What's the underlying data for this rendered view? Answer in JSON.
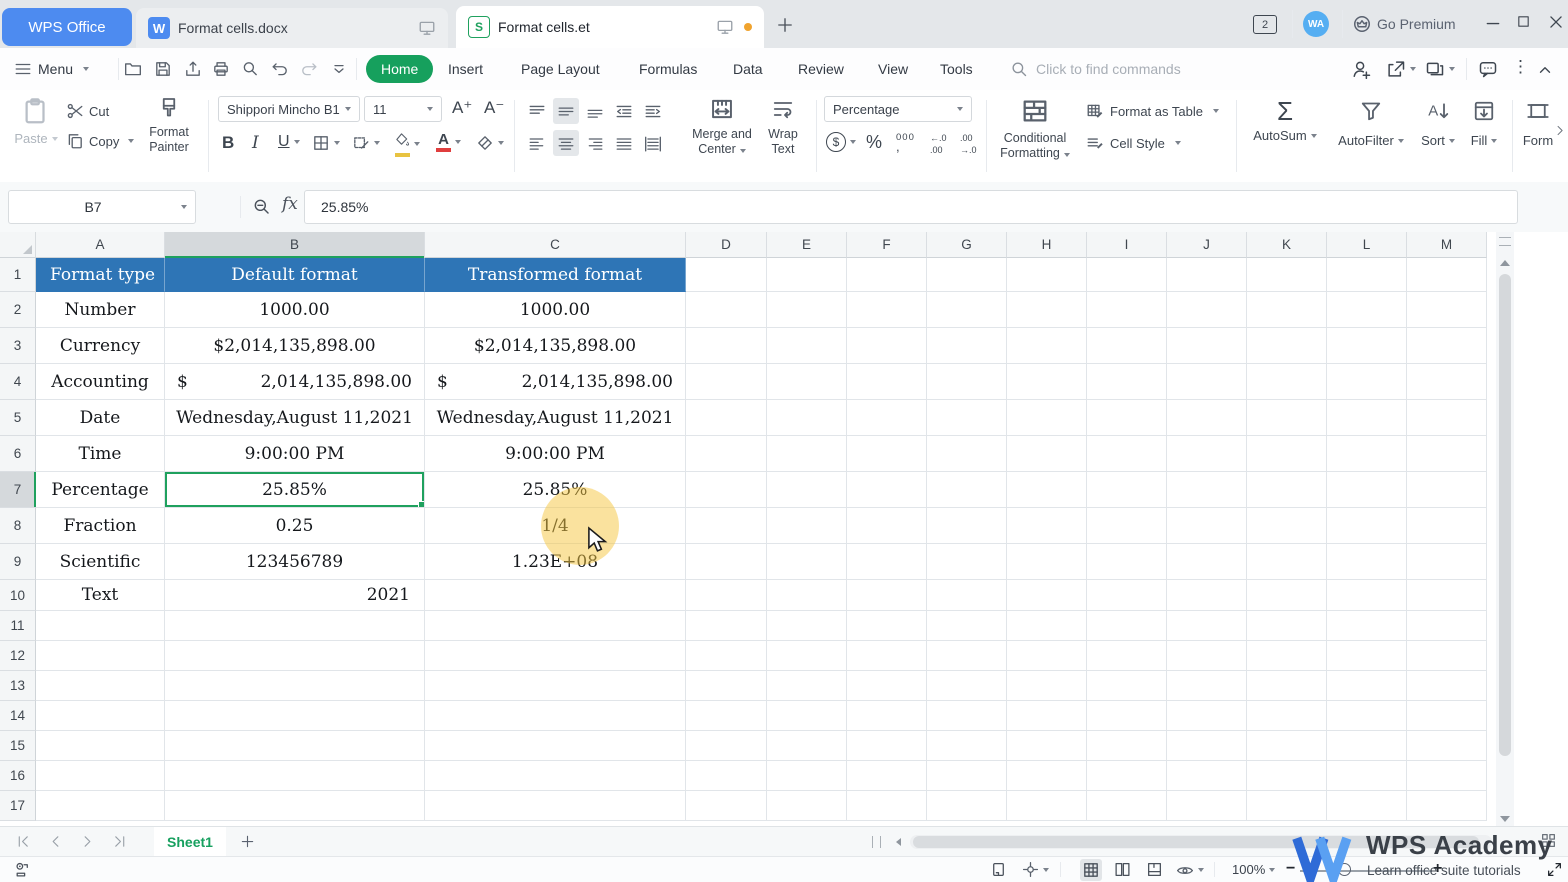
{
  "titlebar": {
    "app_button": "WPS Office",
    "doc_tab": "Format cells.docx",
    "sheet_tab": "Format cells.et",
    "window_count": "2",
    "avatar_initials": "WA",
    "premium_label": "Go Premium"
  },
  "menubar": {
    "menu_label": "Menu",
    "tabs": [
      "Home",
      "Insert",
      "Page Layout",
      "Formulas",
      "Data",
      "Review",
      "View",
      "Tools"
    ],
    "active_tab": "Home",
    "search_placeholder": "Click to find commands"
  },
  "ribbon": {
    "paste": "Paste",
    "cut": "Cut",
    "copy": "Copy",
    "format_painter_line1": "Format",
    "format_painter_line2": "Painter",
    "font_name": "Shippori Mincho B1",
    "font_size": "11",
    "merge_line1": "Merge and",
    "merge_line2": "Center",
    "wrap_line1": "Wrap",
    "wrap_line2": "Text",
    "number_format": "Percentage",
    "cond_line1": "Conditional",
    "cond_line2": "Formatting",
    "format_as_table": "Format as Table",
    "cell_style": "Cell Style",
    "autosum": "AutoSum",
    "autofilter": "AutoFilter",
    "sort": "Sort",
    "fill": "Fill",
    "form": "Form"
  },
  "glyphs": {
    "writer_icon": "W",
    "sheet_icon": "S",
    "bold": "B",
    "italic": "I",
    "underline": "U",
    "grow_font": "A⁺",
    "shrink_font": "A⁻",
    "currency": "$",
    "percent": "%",
    "thousands": "000",
    "thousands_comma": ",",
    "inc_dec_top": "←.0",
    "inc_dec_bottom": ".00",
    "dec_dec_top": ".00",
    "dec_dec_bottom": "→.0",
    "sigma": "Σ",
    "fx": "fx",
    "dots": "⋮",
    "minus": "−",
    "plus": "+"
  },
  "formula_bar": {
    "name_box": "B7",
    "value": "25.85%"
  },
  "sheet": {
    "columns": [
      "A",
      "B",
      "C",
      "D",
      "E",
      "F",
      "G",
      "H",
      "I",
      "J",
      "K",
      "L",
      "M"
    ],
    "row_count": 17,
    "selected_cell": {
      "name": "B7",
      "col": "B",
      "row": 7
    },
    "table_rows": [
      {
        "row": 1,
        "a": "Format type",
        "b": "Default format",
        "c": "Transformed format",
        "type": "header"
      },
      {
        "row": 2,
        "a": "Number",
        "b": "1000.00",
        "c": "1000.00"
      },
      {
        "row": 3,
        "a": "Currency",
        "b": "$2,014,135,898.00",
        "c": "$2,014,135,898.00"
      },
      {
        "row": 4,
        "a": "Accounting",
        "b": "2,014,135,898.00",
        "c": "2,014,135,898.00",
        "currency_symbol": "$",
        "type": "accounting"
      },
      {
        "row": 5,
        "a": "Date",
        "b": "Wednesday,August 11,2021",
        "c": "Wednesday,August 11,2021"
      },
      {
        "row": 6,
        "a": "Time",
        "b": "9:00:00 PM",
        "c": "9:00:00 PM"
      },
      {
        "row": 7,
        "a": "Percentage",
        "b": "25.85%",
        "c": "25.85%"
      },
      {
        "row": 8,
        "a": "Fraction",
        "b": "0.25",
        "c": "1/4"
      },
      {
        "row": 9,
        "a": "Scientific",
        "b": "123456789",
        "c": "1.23E+08"
      },
      {
        "row": 10,
        "a": "Text",
        "b": "2021",
        "c": "",
        "b_align": "right"
      }
    ]
  },
  "sheetbar": {
    "sheet_name": "Sheet1"
  },
  "statusbar": {
    "zoom_level": "100%"
  },
  "watermark": {
    "title": "WPS Academy",
    "subtitle": "Learn office suite tutorials"
  }
}
